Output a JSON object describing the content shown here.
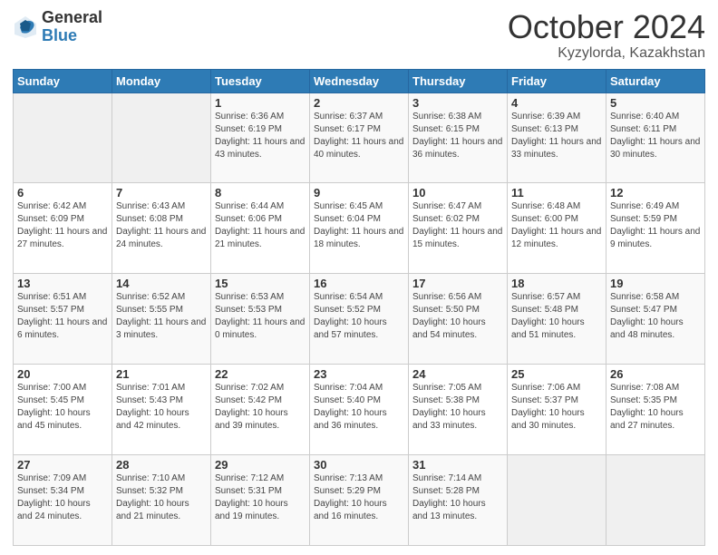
{
  "logo": {
    "general": "General",
    "blue": "Blue"
  },
  "header": {
    "month": "October 2024",
    "location": "Kyzylorda, Kazakhstan"
  },
  "weekdays": [
    "Sunday",
    "Monday",
    "Tuesday",
    "Wednesday",
    "Thursday",
    "Friday",
    "Saturday"
  ],
  "weeks": [
    [
      {
        "day": "",
        "info": ""
      },
      {
        "day": "",
        "info": ""
      },
      {
        "day": "1",
        "info": "Sunrise: 6:36 AM\nSunset: 6:19 PM\nDaylight: 11 hours and 43 minutes."
      },
      {
        "day": "2",
        "info": "Sunrise: 6:37 AM\nSunset: 6:17 PM\nDaylight: 11 hours and 40 minutes."
      },
      {
        "day": "3",
        "info": "Sunrise: 6:38 AM\nSunset: 6:15 PM\nDaylight: 11 hours and 36 minutes."
      },
      {
        "day": "4",
        "info": "Sunrise: 6:39 AM\nSunset: 6:13 PM\nDaylight: 11 hours and 33 minutes."
      },
      {
        "day": "5",
        "info": "Sunrise: 6:40 AM\nSunset: 6:11 PM\nDaylight: 11 hours and 30 minutes."
      }
    ],
    [
      {
        "day": "6",
        "info": "Sunrise: 6:42 AM\nSunset: 6:09 PM\nDaylight: 11 hours and 27 minutes."
      },
      {
        "day": "7",
        "info": "Sunrise: 6:43 AM\nSunset: 6:08 PM\nDaylight: 11 hours and 24 minutes."
      },
      {
        "day": "8",
        "info": "Sunrise: 6:44 AM\nSunset: 6:06 PM\nDaylight: 11 hours and 21 minutes."
      },
      {
        "day": "9",
        "info": "Sunrise: 6:45 AM\nSunset: 6:04 PM\nDaylight: 11 hours and 18 minutes."
      },
      {
        "day": "10",
        "info": "Sunrise: 6:47 AM\nSunset: 6:02 PM\nDaylight: 11 hours and 15 minutes."
      },
      {
        "day": "11",
        "info": "Sunrise: 6:48 AM\nSunset: 6:00 PM\nDaylight: 11 hours and 12 minutes."
      },
      {
        "day": "12",
        "info": "Sunrise: 6:49 AM\nSunset: 5:59 PM\nDaylight: 11 hours and 9 minutes."
      }
    ],
    [
      {
        "day": "13",
        "info": "Sunrise: 6:51 AM\nSunset: 5:57 PM\nDaylight: 11 hours and 6 minutes."
      },
      {
        "day": "14",
        "info": "Sunrise: 6:52 AM\nSunset: 5:55 PM\nDaylight: 11 hours and 3 minutes."
      },
      {
        "day": "15",
        "info": "Sunrise: 6:53 AM\nSunset: 5:53 PM\nDaylight: 11 hours and 0 minutes."
      },
      {
        "day": "16",
        "info": "Sunrise: 6:54 AM\nSunset: 5:52 PM\nDaylight: 10 hours and 57 minutes."
      },
      {
        "day": "17",
        "info": "Sunrise: 6:56 AM\nSunset: 5:50 PM\nDaylight: 10 hours and 54 minutes."
      },
      {
        "day": "18",
        "info": "Sunrise: 6:57 AM\nSunset: 5:48 PM\nDaylight: 10 hours and 51 minutes."
      },
      {
        "day": "19",
        "info": "Sunrise: 6:58 AM\nSunset: 5:47 PM\nDaylight: 10 hours and 48 minutes."
      }
    ],
    [
      {
        "day": "20",
        "info": "Sunrise: 7:00 AM\nSunset: 5:45 PM\nDaylight: 10 hours and 45 minutes."
      },
      {
        "day": "21",
        "info": "Sunrise: 7:01 AM\nSunset: 5:43 PM\nDaylight: 10 hours and 42 minutes."
      },
      {
        "day": "22",
        "info": "Sunrise: 7:02 AM\nSunset: 5:42 PM\nDaylight: 10 hours and 39 minutes."
      },
      {
        "day": "23",
        "info": "Sunrise: 7:04 AM\nSunset: 5:40 PM\nDaylight: 10 hours and 36 minutes."
      },
      {
        "day": "24",
        "info": "Sunrise: 7:05 AM\nSunset: 5:38 PM\nDaylight: 10 hours and 33 minutes."
      },
      {
        "day": "25",
        "info": "Sunrise: 7:06 AM\nSunset: 5:37 PM\nDaylight: 10 hours and 30 minutes."
      },
      {
        "day": "26",
        "info": "Sunrise: 7:08 AM\nSunset: 5:35 PM\nDaylight: 10 hours and 27 minutes."
      }
    ],
    [
      {
        "day": "27",
        "info": "Sunrise: 7:09 AM\nSunset: 5:34 PM\nDaylight: 10 hours and 24 minutes."
      },
      {
        "day": "28",
        "info": "Sunrise: 7:10 AM\nSunset: 5:32 PM\nDaylight: 10 hours and 21 minutes."
      },
      {
        "day": "29",
        "info": "Sunrise: 7:12 AM\nSunset: 5:31 PM\nDaylight: 10 hours and 19 minutes."
      },
      {
        "day": "30",
        "info": "Sunrise: 7:13 AM\nSunset: 5:29 PM\nDaylight: 10 hours and 16 minutes."
      },
      {
        "day": "31",
        "info": "Sunrise: 7:14 AM\nSunset: 5:28 PM\nDaylight: 10 hours and 13 minutes."
      },
      {
        "day": "",
        "info": ""
      },
      {
        "day": "",
        "info": ""
      }
    ]
  ]
}
